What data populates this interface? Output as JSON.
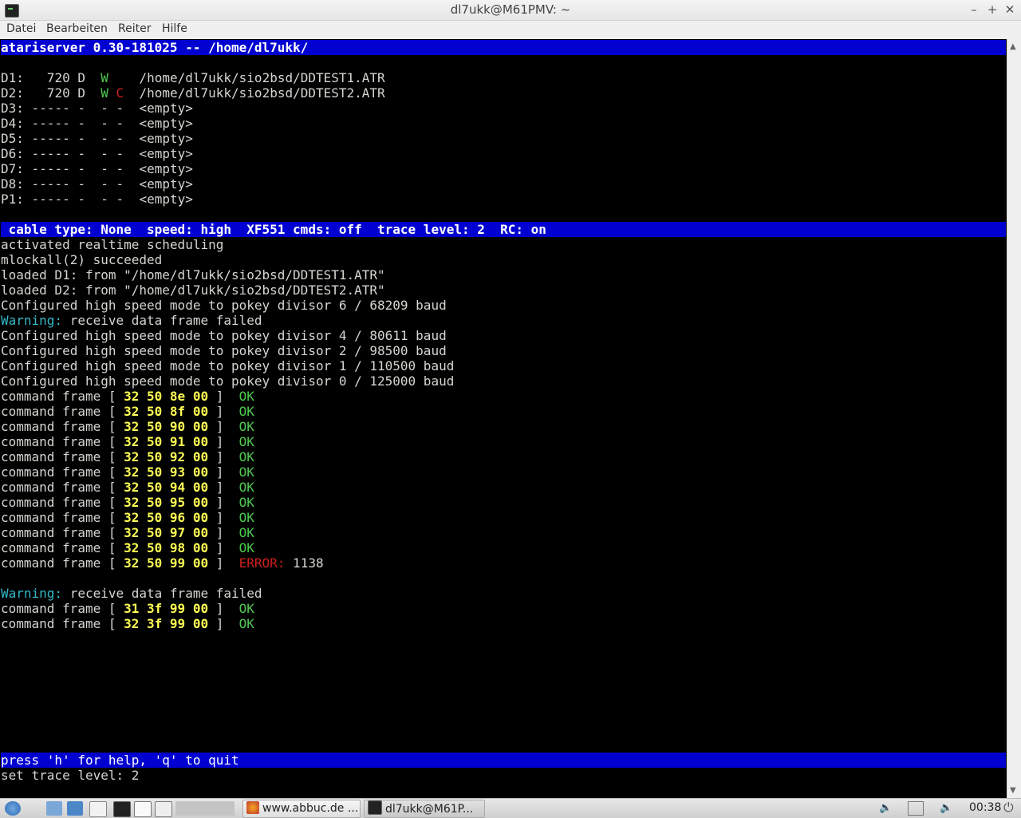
{
  "window": {
    "title": "dl7ukk@M61PMV: ~",
    "minimize_glyph": "–",
    "maximize_glyph": "+",
    "close_glyph": "✕"
  },
  "menu": [
    "Datei",
    "Bearbeiten",
    "Reiter",
    "Hilfe"
  ],
  "terminal": {
    "header": "atariserver 0.30-181025 -- /home/dl7ukk/",
    "drives": [
      {
        "id": "D1:",
        "size": "  720",
        "dens": "D",
        "w": "W",
        "c": " ",
        "path": "/home/dl7ukk/sio2bsd/DDTEST1.ATR",
        "empty": false
      },
      {
        "id": "D2:",
        "size": "  720",
        "dens": "D",
        "w": "W",
        "c": "C",
        "path": "/home/dl7ukk/sio2bsd/DDTEST2.ATR",
        "empty": false
      },
      {
        "id": "D3:",
        "size": "-----",
        "dens": "-",
        "w": "-",
        "c": "-",
        "path": "<empty>",
        "empty": true
      },
      {
        "id": "D4:",
        "size": "-----",
        "dens": "-",
        "w": "-",
        "c": "-",
        "path": "<empty>",
        "empty": true
      },
      {
        "id": "D5:",
        "size": "-----",
        "dens": "-",
        "w": "-",
        "c": "-",
        "path": "<empty>",
        "empty": true
      },
      {
        "id": "D6:",
        "size": "-----",
        "dens": "-",
        "w": "-",
        "c": "-",
        "path": "<empty>",
        "empty": true
      },
      {
        "id": "D7:",
        "size": "-----",
        "dens": "-",
        "w": "-",
        "c": "-",
        "path": "<empty>",
        "empty": true
      },
      {
        "id": "D8:",
        "size": "-----",
        "dens": "-",
        "w": "-",
        "c": "-",
        "path": "<empty>",
        "empty": true
      },
      {
        "id": "P1:",
        "size": "-----",
        "dens": "-",
        "w": "-",
        "c": "-",
        "path": "<empty>",
        "empty": true
      }
    ],
    "status_bar": " cable type: None  speed: high  XF551 cmds: off  trace level: 2  RC: on",
    "log": [
      {
        "kind": "text",
        "text": "activated realtime scheduling"
      },
      {
        "kind": "text",
        "text": "mlockall(2) succeeded"
      },
      {
        "kind": "text",
        "text": "loaded D1: from \"/home/dl7ukk/sio2bsd/DDTEST1.ATR\""
      },
      {
        "kind": "text",
        "text": "loaded D2: from \"/home/dl7ukk/sio2bsd/DDTEST2.ATR\""
      },
      {
        "kind": "text",
        "text": "Configured high speed mode to pokey divisor 6 / 68209 baud"
      },
      {
        "kind": "warn",
        "label": "Warning:",
        "text": " receive data frame failed"
      },
      {
        "kind": "text",
        "text": "Configured high speed mode to pokey divisor 4 / 80611 baud"
      },
      {
        "kind": "text",
        "text": "Configured high speed mode to pokey divisor 2 / 98500 baud"
      },
      {
        "kind": "text",
        "text": "Configured high speed mode to pokey divisor 1 / 110500 baud"
      },
      {
        "kind": "text",
        "text": "Configured high speed mode to pokey divisor 0 / 125000 baud"
      },
      {
        "kind": "cmd",
        "bytes": "32 50 8e 00",
        "status": "OK"
      },
      {
        "kind": "cmd",
        "bytes": "32 50 8f 00",
        "status": "OK"
      },
      {
        "kind": "cmd",
        "bytes": "32 50 90 00",
        "status": "OK"
      },
      {
        "kind": "cmd",
        "bytes": "32 50 91 00",
        "status": "OK"
      },
      {
        "kind": "cmd",
        "bytes": "32 50 92 00",
        "status": "OK"
      },
      {
        "kind": "cmd",
        "bytes": "32 50 93 00",
        "status": "OK"
      },
      {
        "kind": "cmd",
        "bytes": "32 50 94 00",
        "status": "OK"
      },
      {
        "kind": "cmd",
        "bytes": "32 50 95 00",
        "status": "OK"
      },
      {
        "kind": "cmd",
        "bytes": "32 50 96 00",
        "status": "OK"
      },
      {
        "kind": "cmd",
        "bytes": "32 50 97 00",
        "status": "OK"
      },
      {
        "kind": "cmd",
        "bytes": "32 50 98 00",
        "status": "OK"
      },
      {
        "kind": "cmd",
        "bytes": "32 50 99 00",
        "status": "ERROR:",
        "code": " 1138"
      },
      {
        "kind": "text",
        "text": ""
      },
      {
        "kind": "warn",
        "label": "Warning:",
        "text": " receive data frame failed"
      },
      {
        "kind": "cmd",
        "bytes": "31 3f 99 00",
        "status": "OK"
      },
      {
        "kind": "cmd",
        "bytes": "32 3f 99 00",
        "status": "OK"
      }
    ],
    "cmd_prefix": "command frame [ ",
    "cmd_suffix": " ]  ",
    "help_bar": "press 'h' for help, 'q' to quit",
    "prompt_line": "set trace level: 2"
  },
  "taskbar": {
    "tasks": [
      {
        "label": "www.abbuc.de ...",
        "icon": "firefox-icon"
      },
      {
        "label": "dl7ukk@M61P...",
        "icon": "terminal-icon"
      }
    ],
    "clock": "00:38"
  },
  "colors": {
    "bar_blue": "#0000d0",
    "ok_green": "#4ec94e",
    "error_red": "#cc1f1f",
    "warn_cyan": "#34b9c9",
    "bytes_yellow": "#ffff55"
  }
}
